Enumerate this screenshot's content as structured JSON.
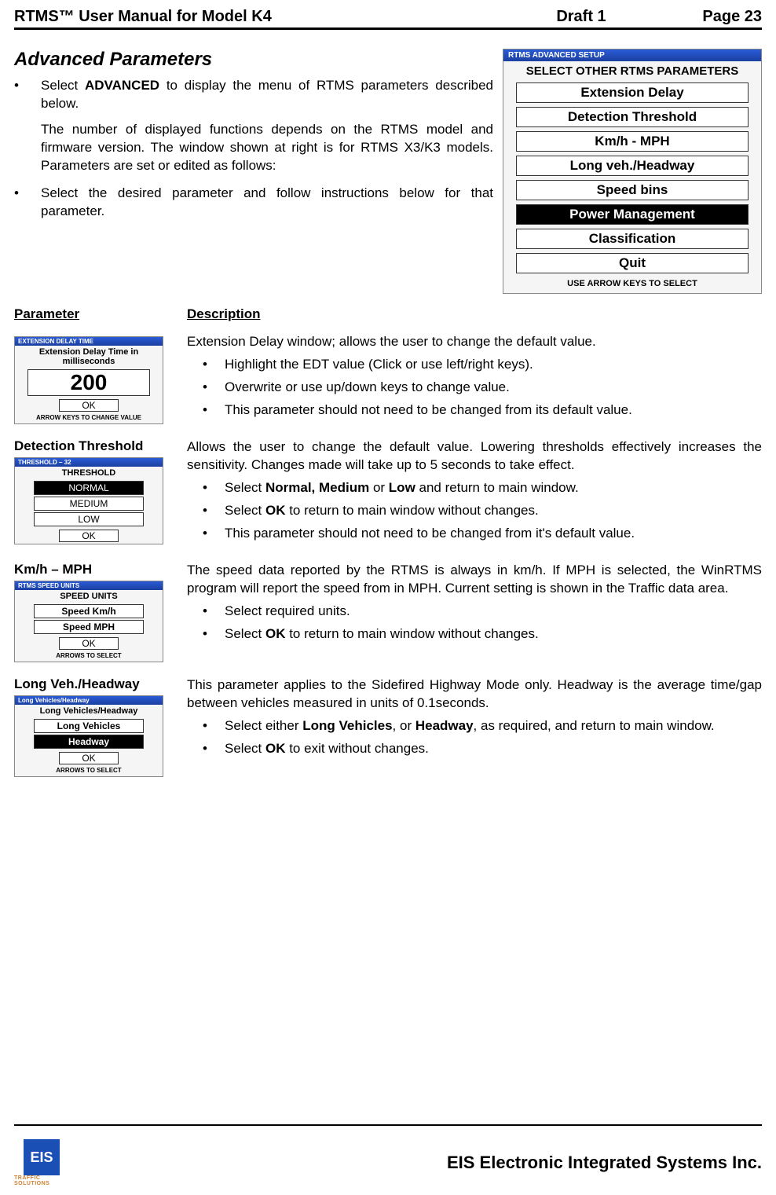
{
  "header": {
    "left": "RTMS™  User Manual for Model K4",
    "mid": "Draft 1",
    "right": "Page 23"
  },
  "intro": {
    "title": "Advanced Parameters",
    "bullets": [
      "Select <b>ADVANCED</b> to display the menu of RTMS parameters described below.",
      "Select the desired parameter and follow instructions below for that parameter."
    ],
    "note": "The number of displayed functions depends on the RTMS model and firmware version.  The window shown at right is for RTMS X3/K3 models. Parameters are set or edited as follows:"
  },
  "adv_dialog": {
    "win_title": "RTMS ADVANCED SETUP",
    "head": "SELECT OTHER RTMS PARAMETERS",
    "options": [
      "Extension Delay",
      "Detection Threshold",
      "Km/h - MPH",
      "Long veh./Headway",
      "Speed bins",
      "Power Management",
      "Classification",
      "Quit"
    ],
    "foot": "USE ARROW KEYS TO SELECT"
  },
  "table_head": {
    "l": "Parameter",
    "r": "Description"
  },
  "rows": [
    {
      "label": "",
      "dialog": {
        "win_title": "EXTENSION DELAY TIME",
        "head": "Extension Delay Time in milliseconds",
        "big_value": "200",
        "ok": "OK",
        "foot": "ARROW KEYS TO CHANGE VALUE"
      },
      "desc_p": "Extension Delay window; allows the user to change the default value.",
      "desc_bullets": [
        "Highlight the EDT value (Click or use left/right keys).",
        "Overwrite or use up/down keys to change value.",
        "This parameter should not need to be changed from its default value."
      ]
    },
    {
      "label": "Detection Threshold",
      "dialog": {
        "win_title": "THRESHOLD – 32",
        "head": "THRESHOLD",
        "options": [
          {
            "t": "NORMAL",
            "inv": true
          },
          {
            "t": "MEDIUM"
          },
          {
            "t": "LOW"
          }
        ],
        "ok": "OK",
        "foot": ""
      },
      "desc_p": "Allows the user to change the default value.  Lowering thresholds effectively increases the sensitivity. Changes made will take up to 5 seconds to take effect.",
      "desc_bullets": [
        "Select <b>Normal, Medium</b> or <b>Low</b> and return to main window.",
        "Select <b>OK</b> to return to main window without changes.",
        "This parameter should not need to be changed from it's default value."
      ]
    },
    {
      "label": "Km/h – MPH",
      "dialog": {
        "win_title": "RTMS SPEED UNITS",
        "head": "SPEED UNITS",
        "options": [
          {
            "t": "Speed Km/h",
            "bold": true
          },
          {
            "t": "Speed MPH",
            "bold": true
          }
        ],
        "ok": "OK",
        "foot": "ARROWS TO SELECT"
      },
      "desc_p": "The speed data reported by the RTMS is always in km/h. If MPH is selected, the WinRTMS program will report the speed from in MPH.  Current setting is shown in the Traffic data area.",
      "desc_bullets": [
        "Select required units.",
        "Select <b>OK</b> to return to main window without changes."
      ]
    },
    {
      "label": "Long Veh./Headway",
      "dialog": {
        "win_title": "Long Vehicles/Headway",
        "head": "Long Vehicles/Headway",
        "options": [
          {
            "t": "Long Vehicles",
            "bold": true
          },
          {
            "t": "Headway",
            "bold": true,
            "inv": true
          }
        ],
        "ok": "OK",
        "foot": "ARROWS TO SELECT"
      },
      "desc_p": "This parameter applies to the Sidefired Highway Mode only. Headway is the average time/gap between vehicles measured in units of 0.1seconds.",
      "desc_bullets": [
        "Select either <b>Long Vehicles</b>, or <b>Headway</b>, as required, and return to main window.",
        "Select <b>OK</b> to exit without changes."
      ]
    }
  ],
  "footer": {
    "logo": "EIS",
    "logosub": "TRAFFIC SOLUTIONS",
    "company": "EIS Electronic Integrated Systems Inc."
  }
}
